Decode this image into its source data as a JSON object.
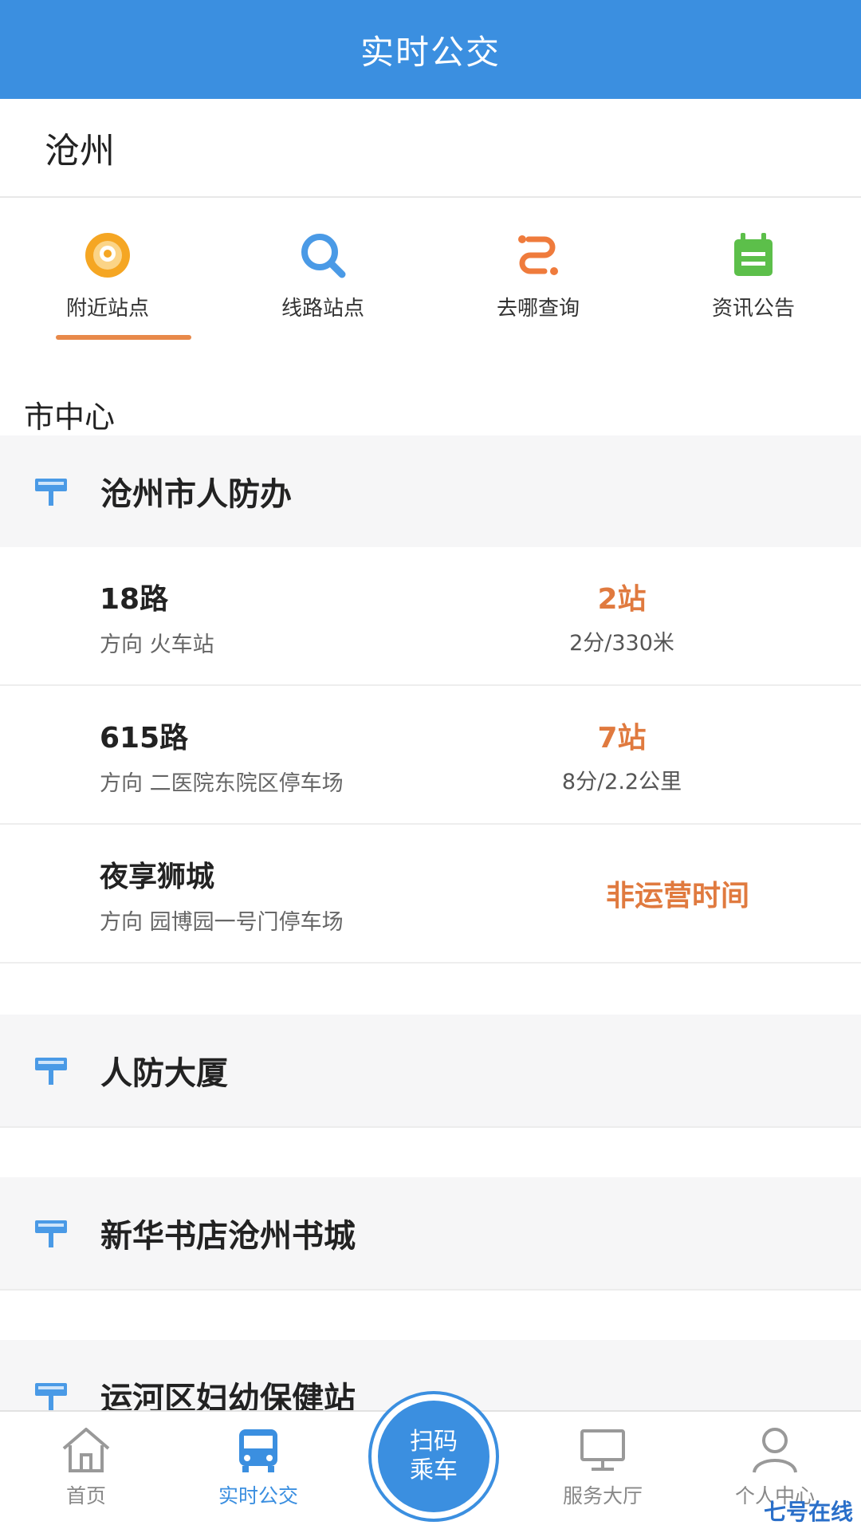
{
  "header": {
    "title": "实时公交"
  },
  "city": {
    "name": "沧州"
  },
  "tabs": [
    {
      "label": "附近站点",
      "icon": "location-pin-icon",
      "active": true
    },
    {
      "label": "线路站点",
      "icon": "search-icon"
    },
    {
      "label": "去哪查询",
      "icon": "route-icon"
    },
    {
      "label": "资讯公告",
      "icon": "notice-board-icon"
    }
  ],
  "area": {
    "name": "市中心"
  },
  "stations": [
    {
      "name": "沧州市人防办",
      "routes": [
        {
          "name": "18路",
          "direction": "方向 火车站",
          "stops": "2站",
          "distance": "2分/330米"
        },
        {
          "name": "615路",
          "direction": "方向 二医院东院区停车场",
          "stops": "7站",
          "distance": "8分/2.2公里"
        },
        {
          "name": "夜享狮城",
          "direction": "方向 园博园一号门停车场",
          "status": "非运营时间"
        }
      ]
    },
    {
      "name": "人防大厦"
    },
    {
      "name": "新华书店沧州书城"
    },
    {
      "name": "运河区妇幼保健站"
    }
  ],
  "nav": {
    "items": [
      {
        "label": "首页",
        "icon": "home-icon"
      },
      {
        "label": "实时公交",
        "icon": "bus-icon",
        "active": true
      },
      {
        "label": "服务大厅",
        "icon": "monitor-icon"
      },
      {
        "label": "个人中心",
        "icon": "user-icon"
      }
    ],
    "scan": {
      "line1": "扫码",
      "line2": "乘车"
    }
  },
  "watermark": "七号在线",
  "colors": {
    "primary": "#3b8fe0",
    "accent": "#e07a3f",
    "underline": "#e8894a"
  }
}
